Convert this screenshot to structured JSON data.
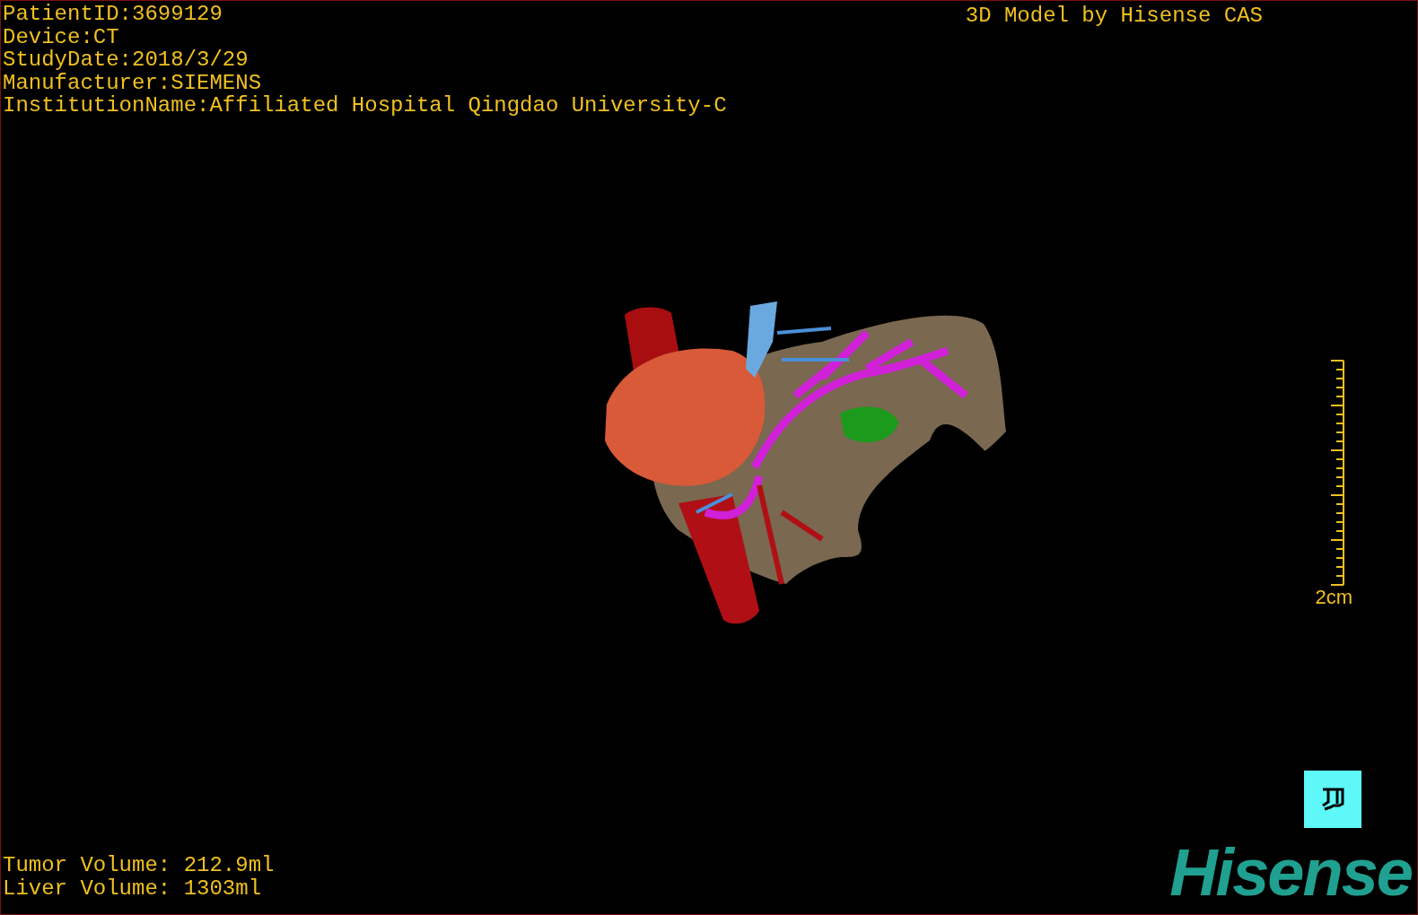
{
  "overlay": {
    "patient_info": [
      "PatientID:3699129",
      "Device:CT",
      "StudyDate:2018/3/29",
      "Manufacturer:SIEMENS",
      "InstitutionName:Affiliated Hospital Qingdao University-C"
    ],
    "credit": "3D Model by Hisense CAS"
  },
  "scale_bar": {
    "label": "2cm"
  },
  "volumes": [
    "Tumor Volume: 212.9ml",
    "Liver Volume: 1303ml"
  ],
  "logo": {
    "text": "Hisense"
  }
}
